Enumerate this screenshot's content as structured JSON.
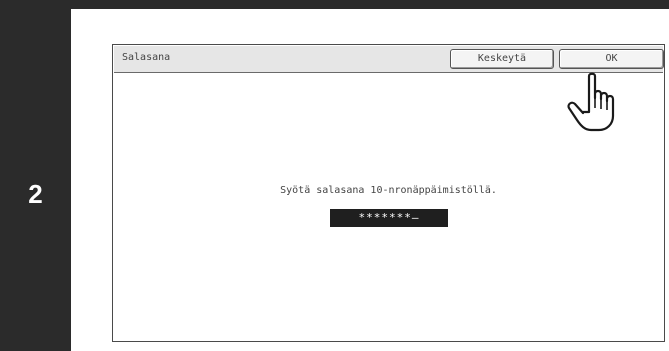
{
  "step": {
    "number": "2"
  },
  "dialog": {
    "title": "Salasana",
    "buttons": {
      "cancel": "Keskeytä",
      "ok": "OK"
    },
    "message": "Syötä salasana 10-nronäppäimistöllä.",
    "password_display": "*******—"
  },
  "icons": {
    "pointer": "pointing-hand-icon"
  }
}
